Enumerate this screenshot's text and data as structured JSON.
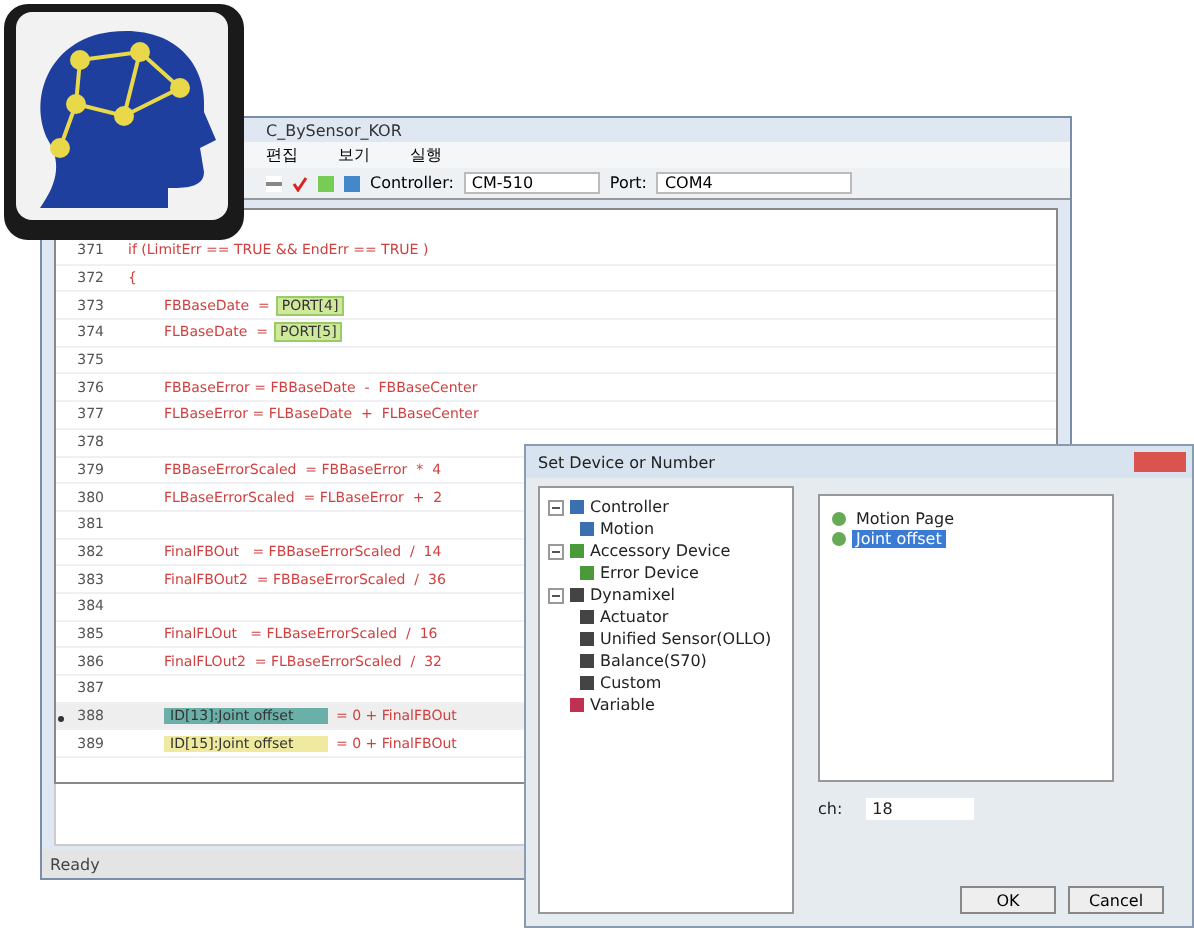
{
  "window": {
    "title": "C_BySensor_KOR",
    "menu": [
      "편집",
      "보기",
      "실행"
    ],
    "toolbar": {
      "controller_label": "Controller:",
      "controller": "CM-510",
      "port_label": "Port:",
      "port": "COM4"
    }
  },
  "code_lines": [
    {
      "number": "371",
      "kind": "code",
      "text": "if (LimitErr == TRUE && EndErr == TRUE )",
      "current": false
    },
    {
      "number": "372",
      "kind": "code",
      "text": "{",
      "current": false
    },
    {
      "number": "373",
      "kind": "port",
      "var": "FBBaseDate  =",
      "chip": "PORT[4]",
      "current": false
    },
    {
      "number": "374",
      "kind": "port",
      "var": "FLBaseDate  =",
      "chip": "PORT[5]",
      "current": false
    },
    {
      "number": "375",
      "kind": "code",
      "current": false
    },
    {
      "number": "376",
      "kind": "code",
      "text": "FBBaseError = FBBaseDate  -  FBBaseCenter",
      "current": false
    },
    {
      "number": "377",
      "kind": "code",
      "text": "FLBaseError = FLBaseDate  +  FLBaseCenter",
      "current": false
    },
    {
      "number": "378",
      "kind": "code",
      "current": false
    },
    {
      "number": "379",
      "kind": "code",
      "text": "FBBaseErrorScaled  = FBBaseError  *  4",
      "current": false
    },
    {
      "number": "380",
      "kind": "code",
      "text": "FLBaseErrorScaled  = FLBaseError  +  2",
      "current": false
    },
    {
      "number": "381",
      "kind": "code",
      "current": false
    },
    {
      "number": "382",
      "kind": "code",
      "text": "FinalFBOut   = FBBaseErrorScaled  /  14",
      "current": false
    },
    {
      "number": "383",
      "kind": "code",
      "text": "FinalFBOut2  = FBBaseErrorScaled  /  36",
      "current": false
    },
    {
      "number": "384",
      "kind": "code",
      "current": false
    },
    {
      "number": "385",
      "kind": "code",
      "text": "FinalFLOut   = FLBaseErrorScaled  /  16",
      "current": false
    },
    {
      "number": "386",
      "kind": "code",
      "text": "FinalFLOut2  = FLBaseErrorScaled  /  32",
      "current": false
    },
    {
      "number": "387",
      "kind": "code",
      "current": false
    },
    {
      "number": "388",
      "kind": "device",
      "chip": "ID[13]:Joint offset",
      "rest": "= 0 + FinalFBOut",
      "current": true
    },
    {
      "number": "389",
      "kind": "device",
      "chip": "ID[15]:Joint offset",
      "rest": "= 0 + FinalFBOut",
      "current": false
    }
  ],
  "status_bar": "Ready",
  "dialog": {
    "title": "Set Device or Number",
    "tree": [
      {
        "label": "Controller",
        "expanded": true,
        "children": [
          {
            "label": "Motion"
          }
        ]
      },
      {
        "label": "Accessory Device",
        "expanded": true,
        "children": [
          {
            "label": "Error Device"
          }
        ]
      },
      {
        "label": "Dynamixel",
        "expanded": true,
        "children": [
          {
            "label": "Actuator"
          },
          {
            "label": "Unified Sensor(OLLO)"
          },
          {
            "label": "Balance(S70)"
          },
          {
            "label": "Custom"
          }
        ]
      },
      {
        "label": "Variable"
      }
    ],
    "list": [
      {
        "label": "Motion Page",
        "selected": false
      },
      {
        "label": "Joint offset",
        "selected": true
      }
    ],
    "ch_label": "ch:",
    "ch_value": "18",
    "buttons": [
      "OK",
      "Cancel"
    ]
  }
}
